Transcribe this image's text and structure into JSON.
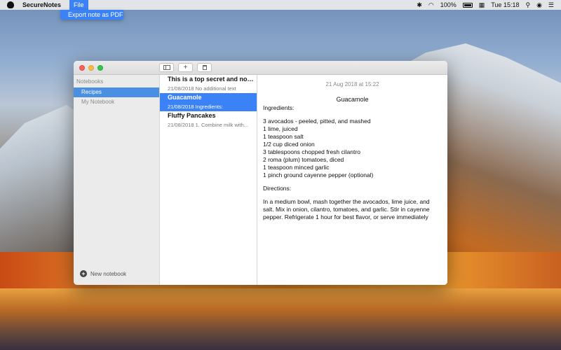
{
  "menubar": {
    "app_name": "SecureNotes",
    "file_menu": "File",
    "battery": "100%",
    "clock": "Tue 15:18"
  },
  "dropdown": {
    "export_pdf": "Export note as PDF"
  },
  "toolbar": {
    "icons": [
      "sidebar-toggle-icon",
      "plus-icon",
      "trash-icon"
    ]
  },
  "sidebar": {
    "header": "Notebooks",
    "items": [
      {
        "label": "Recipes",
        "selected": true
      },
      {
        "label": "My Notebook",
        "selected": false
      }
    ],
    "new_notebook": "New notebook"
  },
  "notes": [
    {
      "title": "This is a top secret and nobo...",
      "subtitle": "21/08/2018 No additional text",
      "selected": false
    },
    {
      "title": "Guacamole",
      "subtitle": "21/08/2018 Ingredients:",
      "selected": true
    },
    {
      "title": "Fluffy Pancakes",
      "subtitle": "21/08/2018 1. Combine milk with...",
      "selected": false
    }
  ],
  "editor": {
    "date": "21 Aug 2018 at 15:22",
    "title": "Guacamole",
    "ingredients_header": "Ingredients:",
    "ingredients": [
      "3 avocados - peeled, pitted, and mashed",
      "1 lime, juiced",
      "1 teaspoon salt",
      "1/2 cup diced onion",
      "3 tablespoons chopped fresh cilantro",
      "2 roma (plum) tomatoes, diced",
      "1 teaspoon minced garlic",
      "1 pinch ground cayenne pepper (optional)"
    ],
    "directions_header": "Directions:",
    "directions": "In a medium bowl, mash together the avocados, lime juice, and salt. Mix in onion, cilantro, tomatoes, and garlic. Stir in cayenne pepper. Refrigerate 1 hour for best flavor, or serve immediately"
  },
  "colors": {
    "selection": "#3b82f6",
    "sidebar_selection": "#4a90e2",
    "close": "#fc605c",
    "minimize": "#fdbc40",
    "zoom": "#34c84a"
  }
}
